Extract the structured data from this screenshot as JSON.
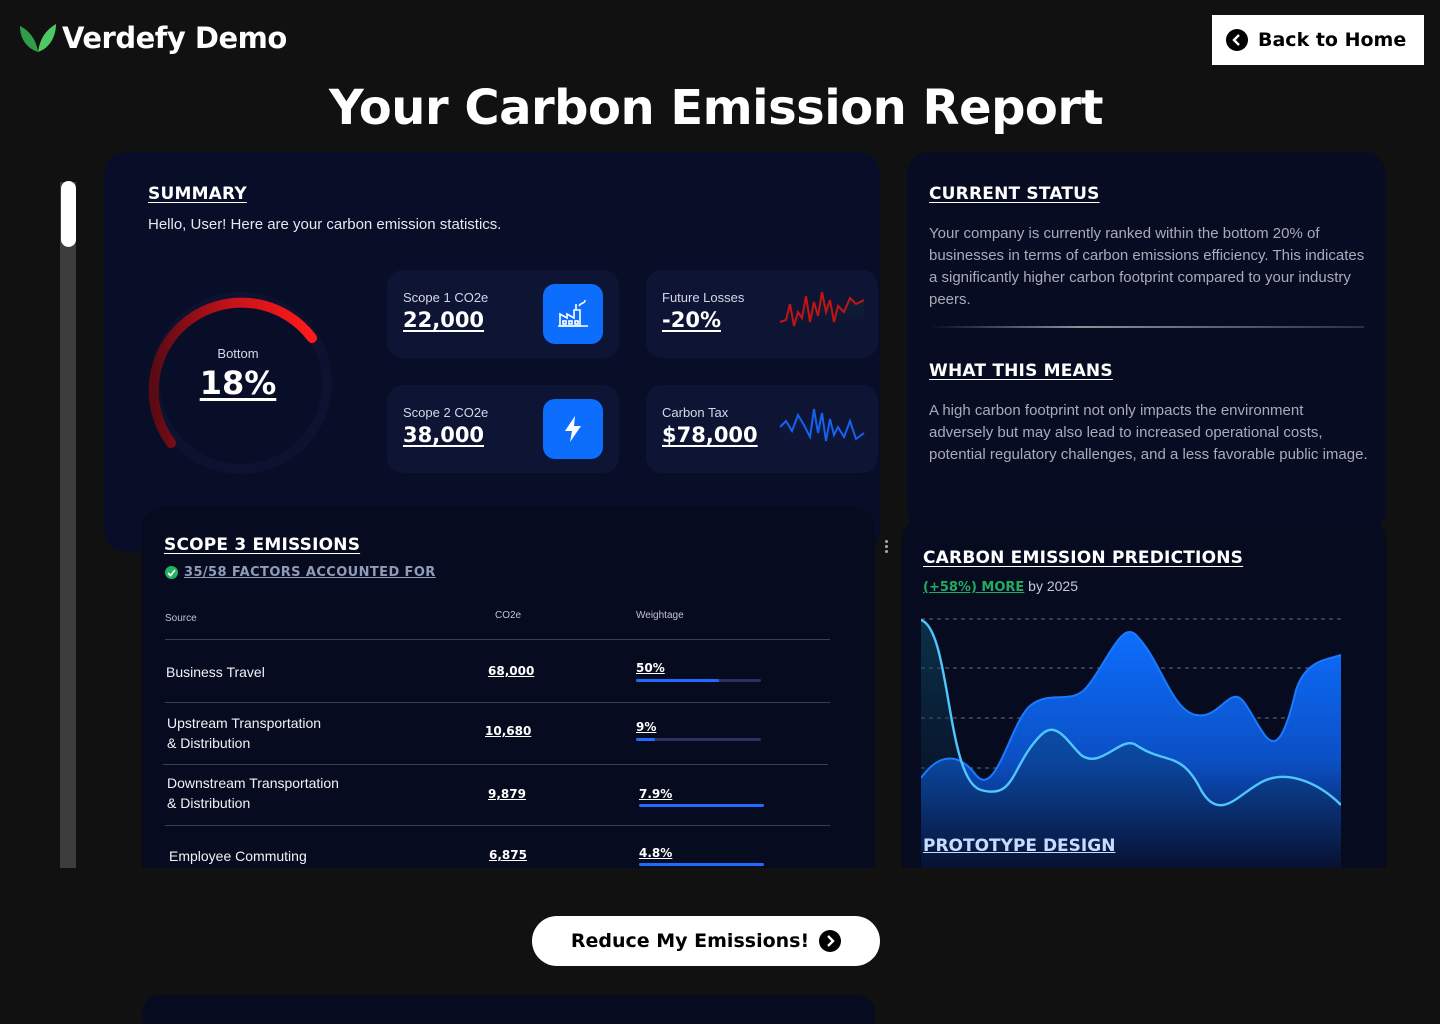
{
  "header": {
    "logo_text": "Verdefy Demo",
    "back_button_label": "Back to Home",
    "page_title": "Your Carbon Emission Report"
  },
  "summary": {
    "heading": "SUMMARY",
    "greeting": "Hello, User! Here are your carbon emission statistics.",
    "rank_label": "Bottom",
    "rank_value": "18%",
    "rank_fraction": 0.18,
    "tiles": [
      {
        "label": "Scope 1 CO2e",
        "value": "22,000",
        "icon": "factory-icon"
      },
      {
        "label": "Future Losses",
        "value": "-20%",
        "icon": "red-sparkline"
      },
      {
        "label": "Scope 2 CO2e",
        "value": "38,000",
        "icon": "lightning-icon"
      },
      {
        "label": "Carbon Tax",
        "value": "$78,000",
        "icon": "blue-sparkline"
      }
    ]
  },
  "status": {
    "current_heading": "CURRENT STATUS",
    "current_text": "Your company is currently ranked within the bottom 20% of businesses in terms of carbon emissions efficiency. This indicates a significantly higher carbon footprint compared to your industry peers.",
    "means_heading": "WHAT THIS MEANS",
    "means_text": "A high carbon footprint not only impacts the environment adversely but may also lead to increased operational costs, potential regulatory challenges, and a less favorable public image."
  },
  "scope3": {
    "heading": "SCOPE 3 EMISSIONS",
    "factors_text": "35/58 FACTORS ACCOUNTED FOR",
    "columns": {
      "source": "Source",
      "co2e": "CO2e",
      "weightage": "Weightage"
    },
    "rows": [
      {
        "source_line1": "Business Travel",
        "source_line2": "",
        "co2e": "68,000",
        "weight": "50%",
        "fill": 0.66
      },
      {
        "source_line1": "Upstream Transportation",
        "source_line2": "& Distribution",
        "co2e": "10,680",
        "weight": "9%",
        "fill": 0.15
      },
      {
        "source_line1": "Downstream Transportation",
        "source_line2": "& Distribution",
        "co2e": "9,879",
        "weight": "7.9%",
        "fill": 1.0
      },
      {
        "source_line1": "Employee Commuting",
        "source_line2": "",
        "co2e": "6,875",
        "weight": "4.8%",
        "fill": 1.0
      }
    ]
  },
  "predictions": {
    "heading": "CARBON EMISSION PREDICTIONS",
    "highlight": "(+58%) MORE",
    "suffix": " by 2025",
    "footer_label": "PROTOTYPE DESIGN"
  },
  "cta": {
    "reduce_label": "Reduce My Emissions!"
  },
  "colors": {
    "accent_blue": "#0d6efd",
    "gauge_red": "#e3141b",
    "success_green": "#1fae5f"
  }
}
